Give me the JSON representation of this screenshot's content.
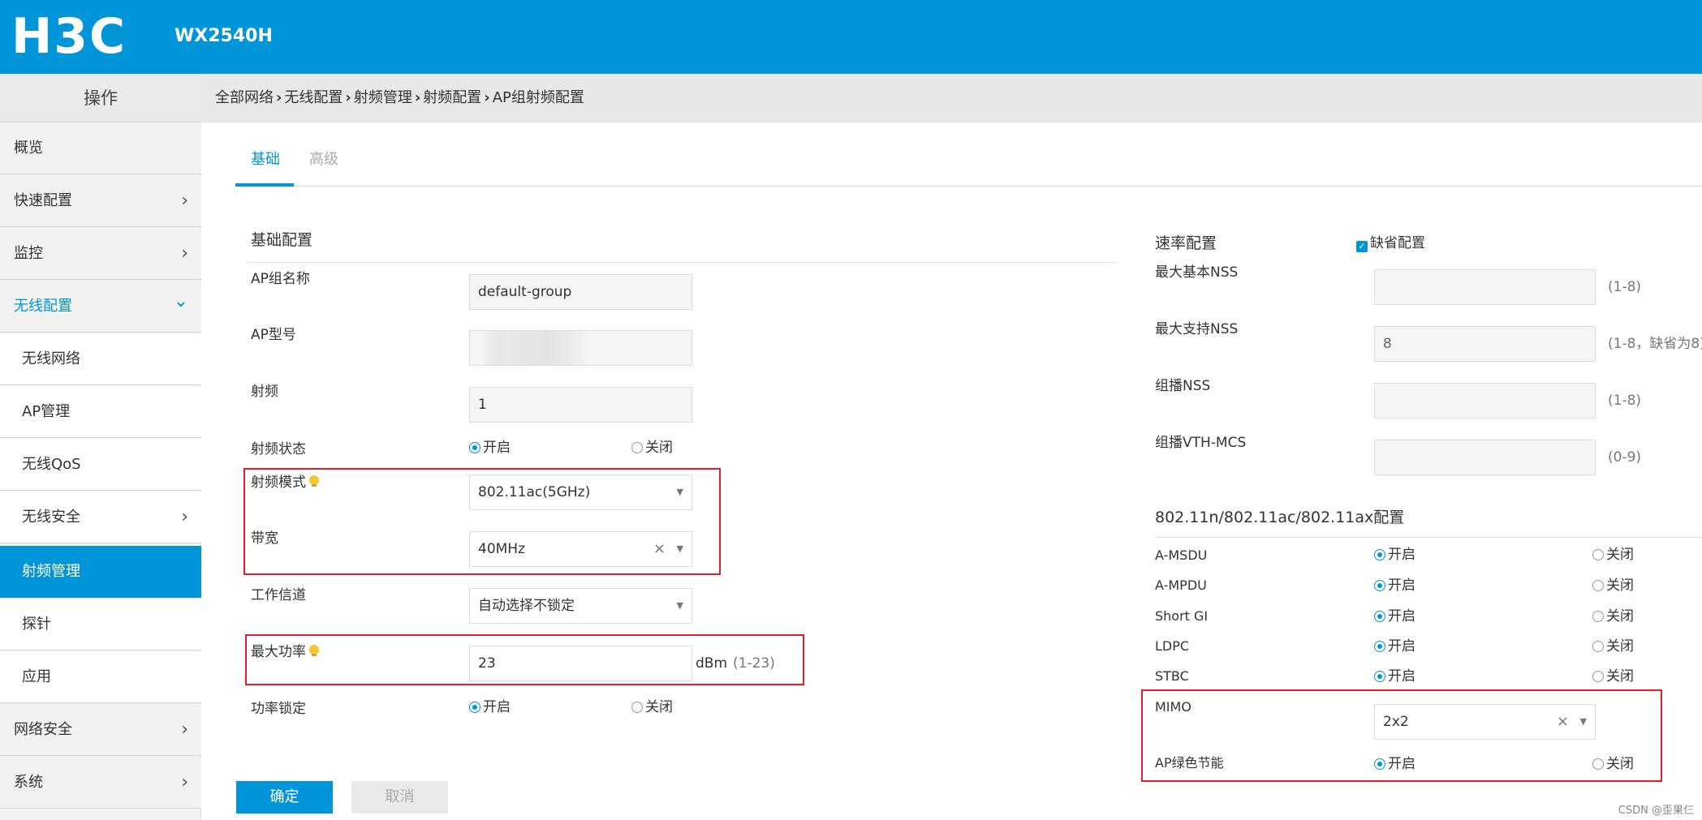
{
  "header": {
    "logo": "H3C",
    "model": "WX2540H",
    "color": "#0095d9"
  },
  "sidebar": {
    "title": "操作",
    "items": [
      {
        "label": "概览"
      },
      {
        "label": "快速配置",
        "chevron": "›"
      },
      {
        "label": "监控",
        "chevron": "›"
      },
      {
        "label": "无线配置",
        "chevron": "⌄"
      },
      {
        "label": "无线网络"
      },
      {
        "label": "AP管理"
      },
      {
        "label": "无线QoS"
      },
      {
        "label": "无线安全",
        "chevron": "›"
      },
      {
        "label": "射频管理"
      },
      {
        "label": "探针"
      },
      {
        "label": "应用"
      },
      {
        "label": "网络安全",
        "chevron": "›"
      },
      {
        "label": "系统",
        "chevron": "›"
      }
    ]
  },
  "breadcrumb": {
    "items": [
      "全部网络",
      "无线配置",
      "射频管理",
      "射频配置",
      "AP组射频配置"
    ],
    "sep": "›"
  },
  "tabs": [
    {
      "label": "基础"
    },
    {
      "label": "高级"
    }
  ],
  "basic": {
    "title": "基础配置",
    "ap_group_name": {
      "label": "AP组名称",
      "value": "default-group"
    },
    "ap_model": {
      "label": "AP型号",
      "value": ""
    },
    "radio": {
      "label": "射频",
      "value": "1"
    },
    "radio_state": {
      "label": "射频状态",
      "on": "开启",
      "off": "关闭"
    },
    "radio_mode": {
      "label": "射频模式",
      "value": "802.11ac(5GHz)"
    },
    "bandwidth": {
      "label": "带宽",
      "value": "40MHz"
    },
    "channel": {
      "label": "工作信道",
      "value": "自动选择不锁定"
    },
    "max_power": {
      "label": "最大功率",
      "value": "23",
      "unit": "dBm",
      "hint": "(1-23)"
    },
    "power_lock": {
      "label": "功率锁定",
      "on": "开启",
      "off": "关闭"
    }
  },
  "rate": {
    "title": "速率配置",
    "default_label": "缺省配置",
    "checkmark": "✓",
    "max_basic_nss": {
      "label": "最大基本NSS",
      "value": "",
      "hint": "(1-8)"
    },
    "max_support_nss": {
      "label": "最大支持NSS",
      "value": "8",
      "hint": "(1-8，缺省为8)"
    },
    "multicast_nss": {
      "label": "组播NSS",
      "value": "",
      "hint": "(1-8)"
    },
    "multicast_vht_mcs": {
      "label": "组播VTH-MCS",
      "value": "",
      "hint": "(0-9)"
    }
  },
  "dot11": {
    "title": "802.11n/802.11ac/802.11ax配置",
    "on": "开启",
    "off": "关闭",
    "rows": [
      {
        "label": "A-MSDU"
      },
      {
        "label": "A-MPDU"
      },
      {
        "label": "Short GI"
      },
      {
        "label": "LDPC"
      },
      {
        "label": "STBC"
      }
    ],
    "mimo": {
      "label": "MIMO",
      "value": "2x2"
    },
    "green": {
      "label": "AP绿色节能"
    }
  },
  "icons": {
    "caret": "▼",
    "clear": "×"
  },
  "buttons": {
    "ok": "确定",
    "cancel": "取消"
  },
  "watermark": "CSDN @歪果仨"
}
